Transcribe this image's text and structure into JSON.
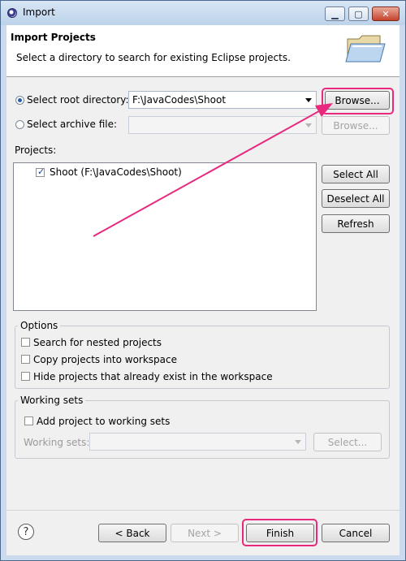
{
  "window": {
    "title": "Import"
  },
  "header": {
    "title": "Import Projects",
    "message": "Select a directory to search for existing Eclipse projects."
  },
  "source": {
    "root_label": "Select root directory:",
    "root_value": "F:\\JavaCodes\\Shoot",
    "browse_label": "Browse...",
    "archive_label": "Select archive file:",
    "archive_browse_label": "Browse..."
  },
  "projects": {
    "label": "Projects:",
    "items": [
      {
        "label": "Shoot (F:\\JavaCodes\\Shoot)",
        "checked": true
      }
    ],
    "select_all": "Select All",
    "deselect_all": "Deselect All",
    "refresh": "Refresh"
  },
  "options": {
    "title": "Options",
    "search_nested": "Search for nested projects",
    "copy_into_workspace": "Copy projects into workspace",
    "hide_existing": "Hide projects that already exist in the workspace"
  },
  "working_sets": {
    "title": "Working sets",
    "add_label": "Add project to working sets",
    "sets_label": "Working sets:",
    "select_label": "Select..."
  },
  "footer": {
    "help": "?",
    "back": "< Back",
    "next": "Next >",
    "finish": "Finish",
    "cancel": "Cancel"
  },
  "highlight_color": "#e8297e"
}
